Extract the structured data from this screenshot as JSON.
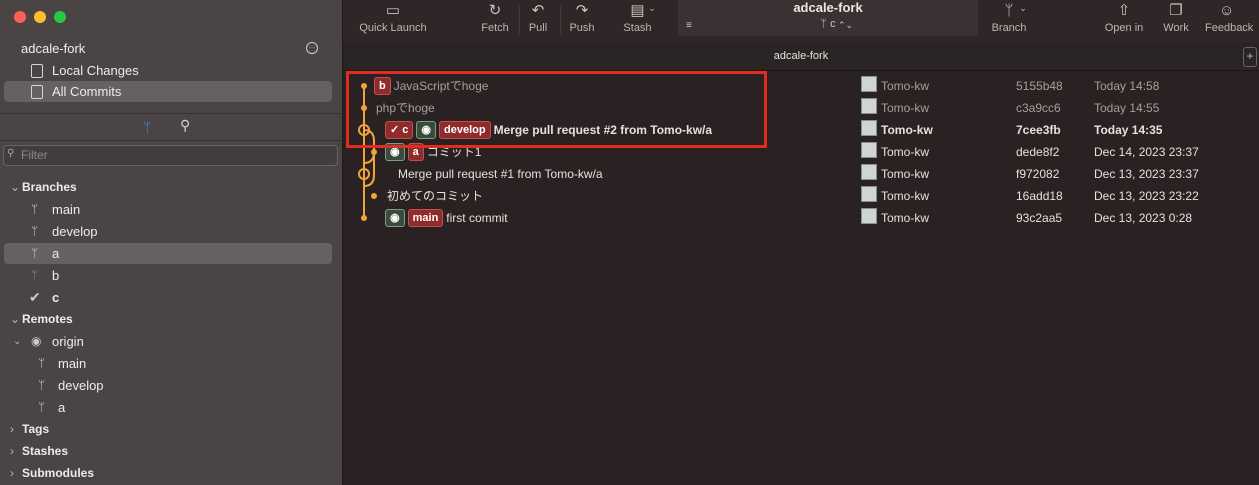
{
  "sidebar": {
    "repo_name": "adcale-fork",
    "nav": [
      {
        "label": "Local Changes"
      },
      {
        "label": "All Commits"
      }
    ],
    "filter_placeholder": "Filter",
    "sections": {
      "branches": "Branches",
      "remotes": "Remotes",
      "tags": "Tags",
      "stashes": "Stashes",
      "submodules": "Submodules"
    },
    "branches": [
      "main",
      "develop",
      "a",
      "b",
      "c"
    ],
    "remote_name": "origin",
    "remote_branches": [
      "main",
      "develop",
      "a"
    ]
  },
  "toolbar": {
    "quick_launch": "Quick Launch",
    "fetch": "Fetch",
    "pull": "Pull",
    "push": "Push",
    "stash": "Stash",
    "repo_title": "adcale-fork",
    "current_branch": "c",
    "branch": "Branch",
    "open_in": "Open in",
    "work": "Work",
    "feedback": "Feedback"
  },
  "tab": {
    "title": "adcale-fork"
  },
  "commits": [
    {
      "tags": [
        {
          "text": "b",
          "style": "red"
        }
      ],
      "message": "JavaScriptでhoge",
      "author": "Tomo-kw",
      "sha": "5155b48",
      "date": "Today 14:58",
      "dim": true,
      "bold": false
    },
    {
      "tags": [],
      "message": "phpでhoge",
      "author": "Tomo-kw",
      "sha": "c3a9cc6",
      "date": "Today 14:55",
      "dim": true,
      "bold": false
    },
    {
      "tags": [
        {
          "text": "✓ c",
          "style": "red"
        },
        {
          "text": "",
          "style": "gh"
        },
        {
          "text": "develop",
          "style": "red"
        }
      ],
      "message": "Merge pull request #2 from Tomo-kw/a",
      "author": "Tomo-kw",
      "sha": "7cee3fb",
      "date": "Today 14:35",
      "dim": false,
      "bold": true
    },
    {
      "tags": [
        {
          "text": "",
          "style": "gh"
        },
        {
          "text": "a",
          "style": "red"
        }
      ],
      "message": "コミット1",
      "author": "Tomo-kw",
      "sha": "dede8f2",
      "date": "Dec 14, 2023 23:37",
      "dim": false,
      "bold": false
    },
    {
      "tags": [],
      "message": "Merge pull request #1 from Tomo-kw/a",
      "author": "Tomo-kw",
      "sha": "f972082",
      "date": "Dec 13, 2023 23:37",
      "dim": false,
      "bold": false
    },
    {
      "tags": [],
      "message": "初めてのコミット",
      "author": "Tomo-kw",
      "sha": "16add18",
      "date": "Dec 13, 2023 23:22",
      "dim": false,
      "bold": false
    },
    {
      "tags": [
        {
          "text": "",
          "style": "gh"
        },
        {
          "text": "main",
          "style": "red"
        }
      ],
      "message": "first commit",
      "author": "Tomo-kw",
      "sha": "93c2aa5",
      "date": "Dec 13, 2023 0:28",
      "dim": false,
      "bold": false
    }
  ],
  "colors": {
    "graph": "#f2a33a",
    "highlight": "#e12c22",
    "accent": "#3d8ef5"
  }
}
